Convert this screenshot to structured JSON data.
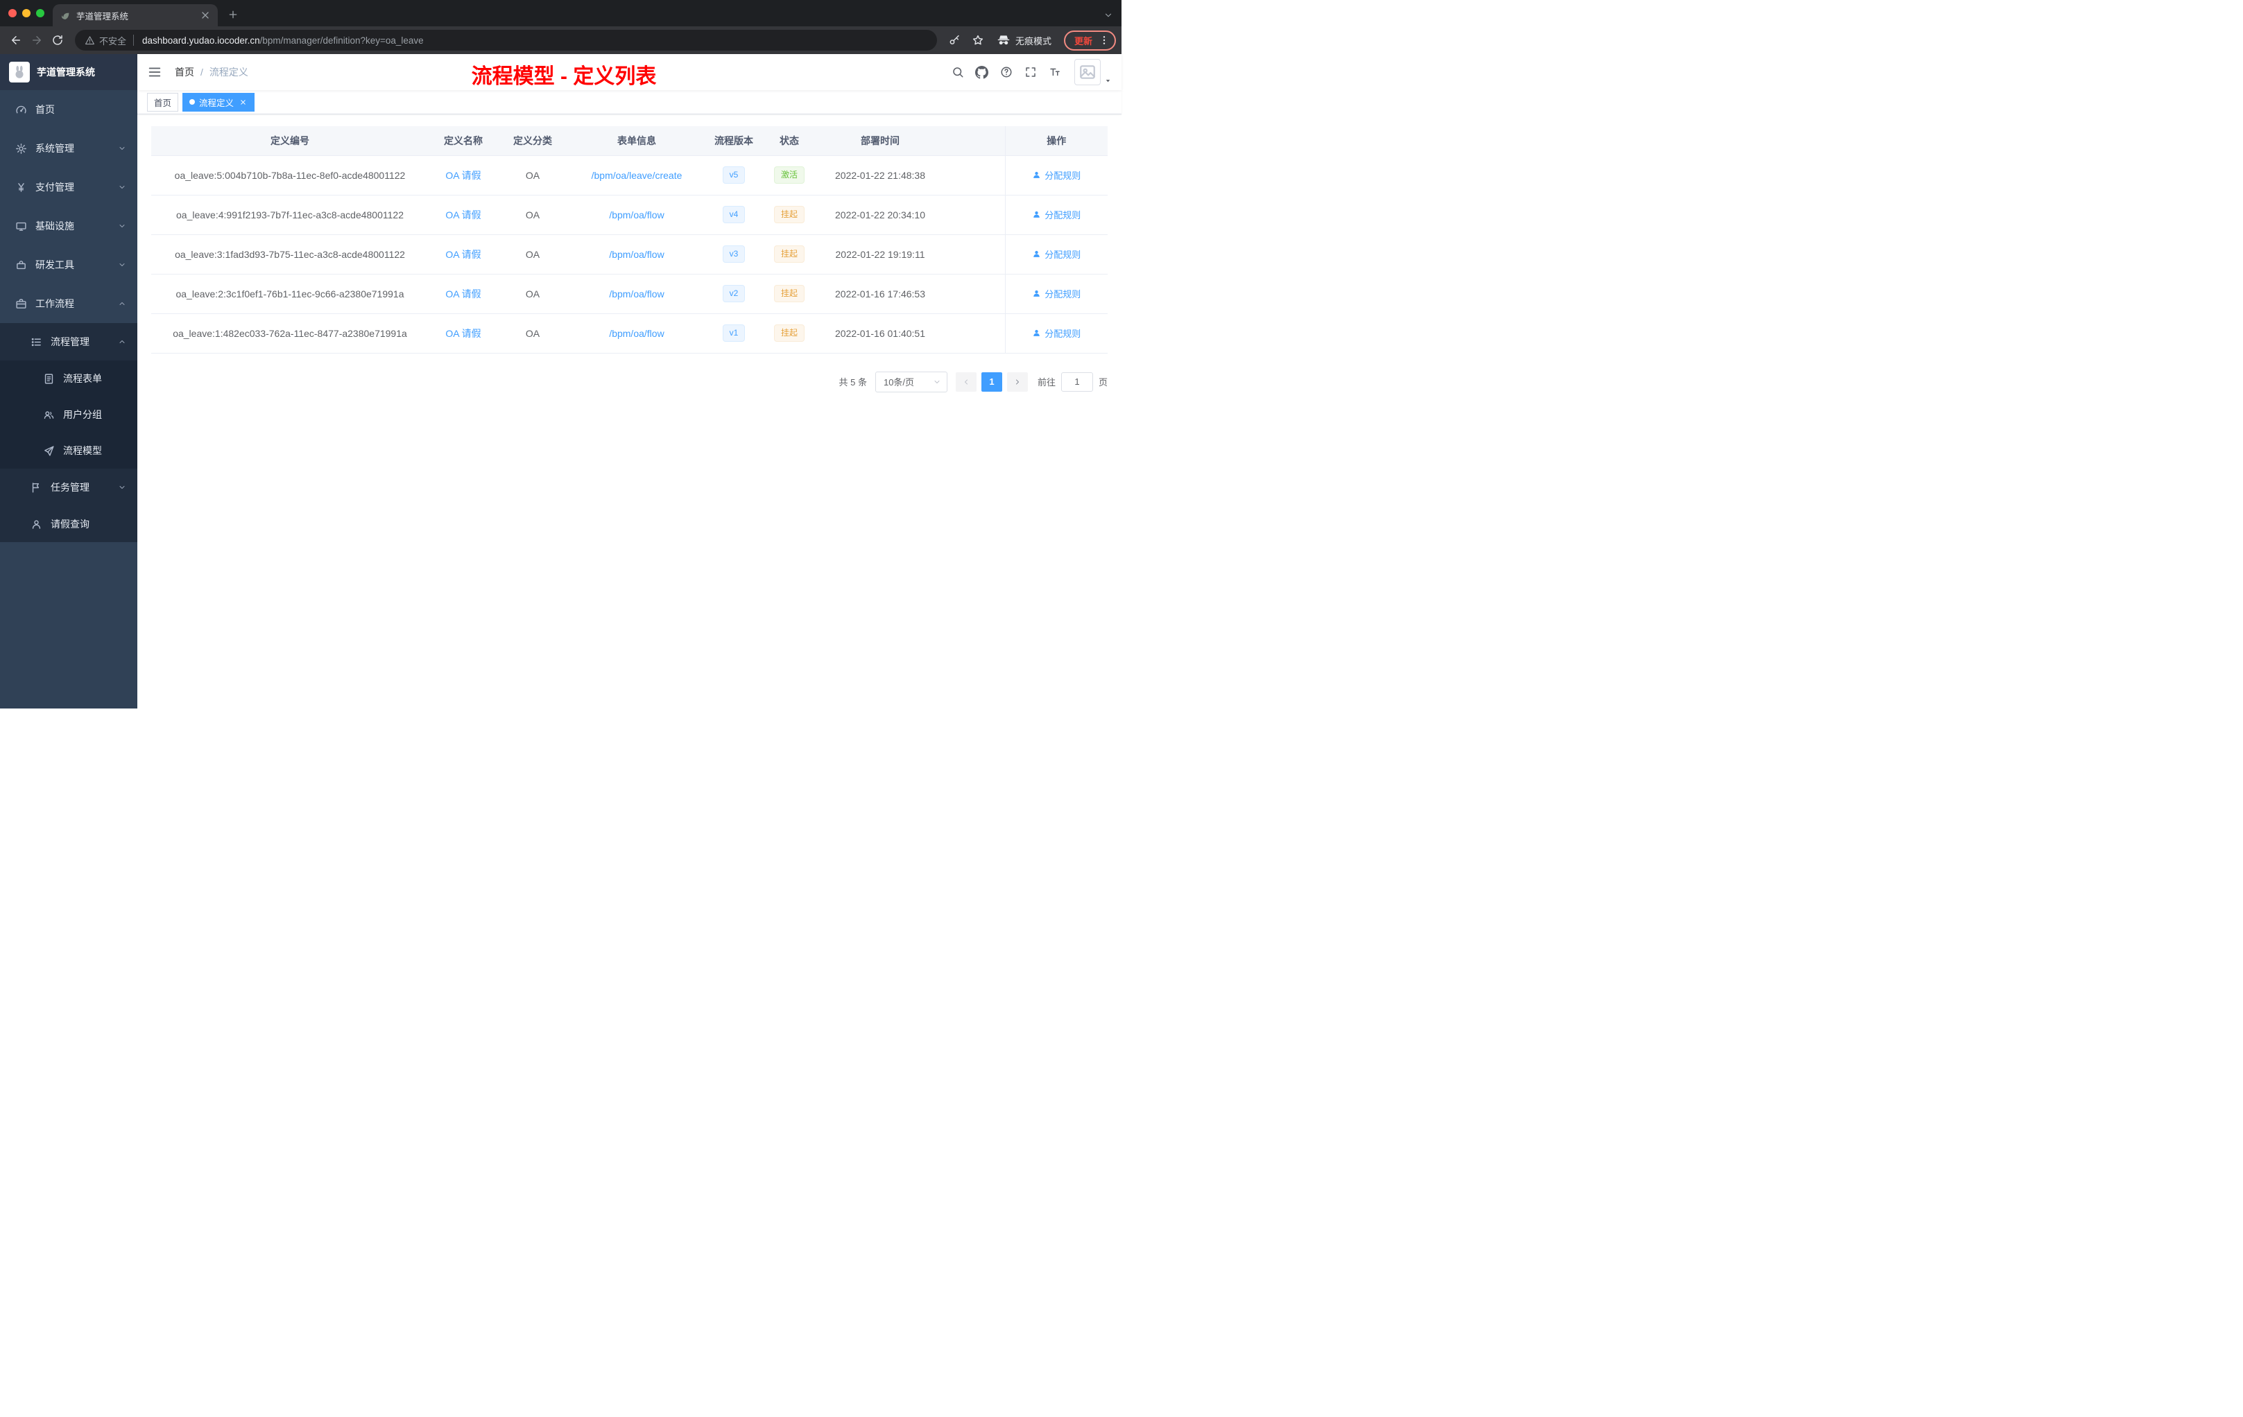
{
  "colors": {
    "accent": "#409EFF",
    "success": "#67C23A",
    "warning": "#E6A23C",
    "annotation_red": "#FF0000",
    "sidebar_bg": "#304156",
    "sidebar_sub_bg": "#212D3E"
  },
  "browser": {
    "tab_title": "芋道管理系统",
    "security_label": "不安全",
    "url_domain": "dashboard.yudao.iocoder.cn",
    "url_path": "/bpm/manager/definition?key=oa_leave",
    "incognito_label": "无痕模式",
    "update_label": "更新"
  },
  "sidebar": {
    "logo_title": "芋道管理系统",
    "menu": [
      {
        "label": "首页",
        "icon": "dashboard-icon"
      },
      {
        "label": "系统管理",
        "icon": "gear-icon"
      },
      {
        "label": "支付管理",
        "icon": "yen-icon"
      },
      {
        "label": "基础设施",
        "icon": "monitor-icon"
      },
      {
        "label": "研发工具",
        "icon": "toolbox-icon"
      },
      {
        "label": "工作流程",
        "icon": "briefcase-icon"
      }
    ],
    "process_group": {
      "label": "流程管理",
      "icon": "list-icon"
    },
    "process_children": [
      {
        "label": "流程表单",
        "icon": "form-icon"
      },
      {
        "label": "用户分组",
        "icon": "users-icon"
      },
      {
        "label": "流程模型",
        "icon": "paper-plane-icon"
      }
    ],
    "task_group": {
      "label": "任务管理",
      "icon": "flag-icon"
    },
    "leave_item": {
      "label": "请假查询",
      "icon": "user-icon"
    }
  },
  "header": {
    "breadcrumb": [
      "首页",
      "流程定义"
    ],
    "breadcrumb_sep": "/",
    "annotation": "流程模型 - 定义列表"
  },
  "tags": [
    {
      "label": "首页"
    },
    {
      "label": "流程定义"
    }
  ],
  "table": {
    "headers": [
      "定义编号",
      "定义名称",
      "定义分类",
      "表单信息",
      "流程版本",
      "状态",
      "部署时间",
      "操作"
    ],
    "action_label": "分配规则",
    "rows": [
      {
        "id": "oa_leave:5:004b710b-7b8a-11ec-8ef0-acde48001122",
        "name": "OA 请假",
        "category": "OA",
        "form": "/bpm/oa/leave/create",
        "version": "v5",
        "status": "激活",
        "time": "2022-01-22 21:48:38"
      },
      {
        "id": "oa_leave:4:991f2193-7b7f-11ec-a3c8-acde48001122",
        "name": "OA 请假",
        "category": "OA",
        "form": "/bpm/oa/flow",
        "version": "v4",
        "status": "挂起",
        "time": "2022-01-22 20:34:10"
      },
      {
        "id": "oa_leave:3:1fad3d93-7b75-11ec-a3c8-acde48001122",
        "name": "OA 请假",
        "category": "OA",
        "form": "/bpm/oa/flow",
        "version": "v3",
        "status": "挂起",
        "time": "2022-01-22 19:19:11"
      },
      {
        "id": "oa_leave:2:3c1f0ef1-76b1-11ec-9c66-a2380e71991a",
        "name": "OA 请假",
        "category": "OA",
        "form": "/bpm/oa/flow",
        "version": "v2",
        "status": "挂起",
        "time": "2022-01-16 17:46:53"
      },
      {
        "id": "oa_leave:1:482ec033-762a-11ec-8477-a2380e71991a",
        "name": "OA 请假",
        "category": "OA",
        "form": "/bpm/oa/flow",
        "version": "v1",
        "status": "挂起",
        "time": "2022-01-16 01:40:51"
      }
    ]
  },
  "pagination": {
    "total": "共 5 条",
    "page_size": "10条/页",
    "current_page": "1",
    "goto_label": "前往",
    "goto_value": "1",
    "goto_unit": "页"
  }
}
